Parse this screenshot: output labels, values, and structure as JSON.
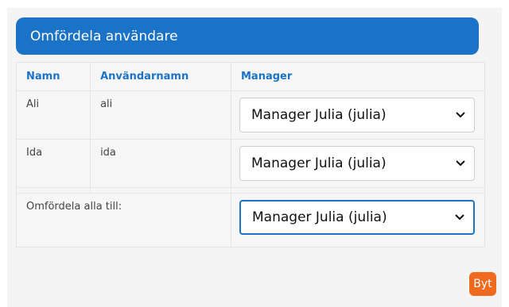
{
  "header": {
    "title": "Omfördela användare"
  },
  "table": {
    "columns": [
      "Namn",
      "Användarnamn",
      "Manager"
    ],
    "rows": [
      {
        "name": "Ali",
        "username": "ali",
        "manager": "Manager Julia (julia)"
      },
      {
        "name": "Ida",
        "username": "ida",
        "manager": "Manager Julia (julia)"
      }
    ],
    "reassign_all_label": "Omfördela alla till:",
    "reassign_all_value": "Manager Julia (julia)"
  },
  "actions": {
    "swap_label": "Byt"
  },
  "colors": {
    "accent": "#1a73c6",
    "button": "#ef6a1e"
  },
  "icons": {
    "select_arrow": "chevron-down-icon"
  }
}
